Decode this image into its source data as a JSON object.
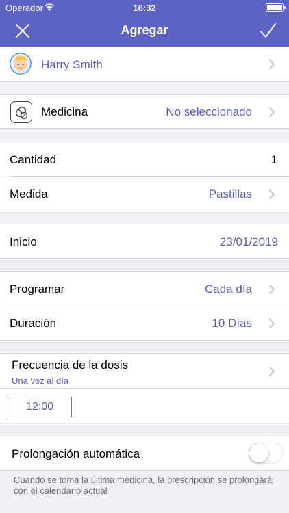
{
  "status_bar": {
    "carrier": "Operador",
    "time": "16:32"
  },
  "nav": {
    "title": "Agregar"
  },
  "profile": {
    "name": "Harry Smith"
  },
  "medicine": {
    "label": "Medicina",
    "value": "No seleccionado"
  },
  "quantity": {
    "label": "Cantidad",
    "value": "1"
  },
  "measure": {
    "label": "Medida",
    "value": "Pastillas"
  },
  "start": {
    "label": "Inicio",
    "value": "23/01/2019"
  },
  "schedule": {
    "label": "Programar",
    "value": "Cada día"
  },
  "duration": {
    "label": "Duración",
    "value": "10 Días"
  },
  "frequency": {
    "label": "Frecuencia de la dosis",
    "subtitle": "Una vez al día",
    "time": "12:00"
  },
  "auto_extend": {
    "label": "Prolongación automática",
    "enabled": false,
    "note": "Cuando se toma la última medicina, la prescripción se prolongará con el calendario actual"
  },
  "colors": {
    "accent": "#5d63c5",
    "value_text": "#5a60b3",
    "background": "#efeff4"
  }
}
